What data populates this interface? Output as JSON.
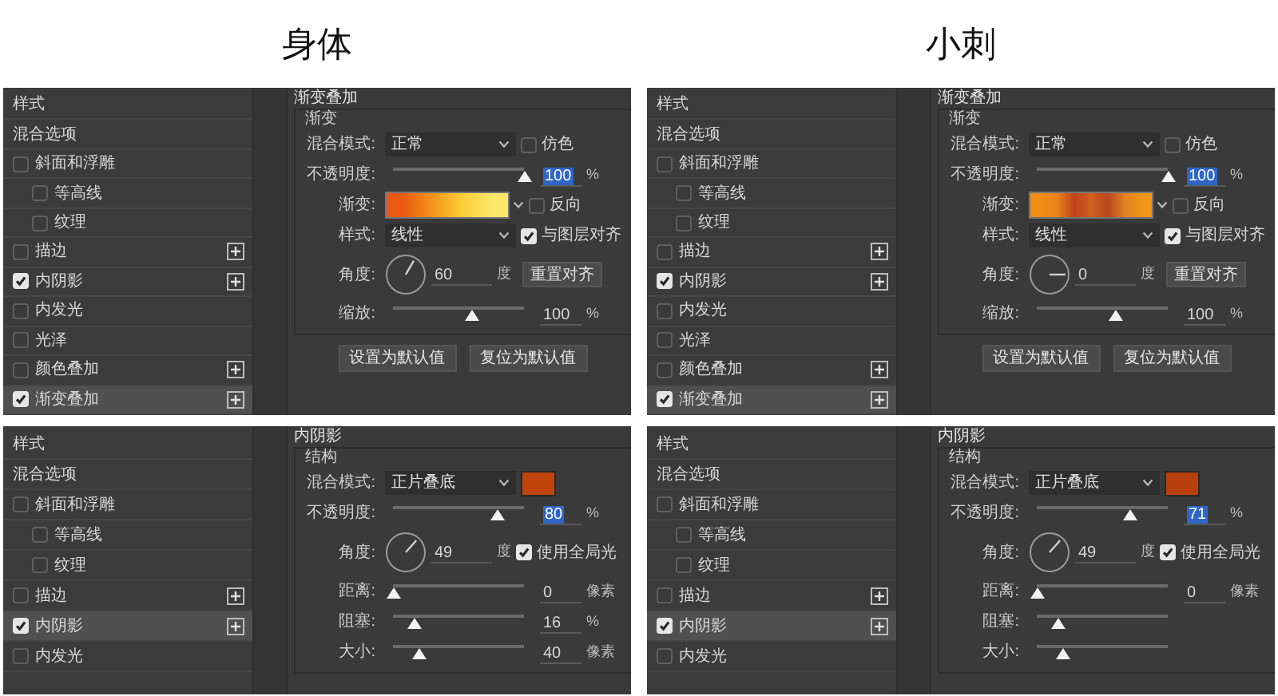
{
  "columns": [
    {
      "heading": "身体",
      "panels": [
        {
          "kind": "gradient_overlay",
          "style_list": {
            "title": "样式",
            "items": [
              {
                "kind": "plain",
                "label": "混合选项",
                "selected": false
              },
              {
                "kind": "checkbox",
                "label": "斜面和浮雕",
                "checked": false,
                "selected": false,
                "add_button": false,
                "children": [
                  {
                    "kind": "checkbox",
                    "label": "等高线",
                    "checked": false,
                    "selected": false,
                    "add_button": false
                  },
                  {
                    "kind": "checkbox",
                    "label": "纹理",
                    "checked": false,
                    "selected": false,
                    "add_button": false
                  }
                ]
              },
              {
                "kind": "checkbox",
                "label": "描边",
                "checked": false,
                "selected": false,
                "add_button": true
              },
              {
                "kind": "checkbox",
                "label": "内阴影",
                "checked": true,
                "selected": false,
                "add_button": true
              },
              {
                "kind": "checkbox",
                "label": "内发光",
                "checked": false,
                "selected": false,
                "add_button": false
              },
              {
                "kind": "checkbox",
                "label": "光泽",
                "checked": false,
                "selected": false,
                "add_button": false
              },
              {
                "kind": "checkbox",
                "label": "颜色叠加",
                "checked": false,
                "selected": false,
                "add_button": true
              },
              {
                "kind": "checkbox",
                "label": "渐变叠加",
                "checked": true,
                "selected": true,
                "add_button": true
              }
            ]
          },
          "settings": {
            "title": "渐变叠加",
            "group": "渐变",
            "rows": [
              {
                "kind": "select",
                "label": "混合模式:",
                "value": "正常",
                "option": {
                  "label": "仿色",
                  "checked": false
                }
              },
              {
                "kind": "slider",
                "label": "不透明度:",
                "level": 1,
                "value": "100",
                "unit": "%",
                "highlighted": true
              },
              {
                "kind": "gradient",
                "label": "渐变:",
                "stops": [
                  {
                    "color": "#ea5812"
                  },
                  {
                    "color": "#f4931a"
                  },
                  {
                    "color": "#fbcf38"
                  },
                  {
                    "color": "#fde86c"
                  }
                ],
                "option": {
                  "label": "反向",
                  "checked": false
                }
              },
              {
                "kind": "select",
                "label": "样式:",
                "value": "线性",
                "option": {
                  "label": "与图层对齐",
                  "checked": true
                }
              },
              {
                "kind": "angle",
                "label": "角度:",
                "value": "60",
                "unit": "度",
                "button": "重置对齐"
              },
              {
                "kind": "slider",
                "label": "缩放:",
                "level": 0.6,
                "value": "100",
                "unit": "%",
                "highlighted": false
              }
            ]
          },
          "buttons": [
            "设置为默认值",
            "复位为默认值"
          ]
        },
        {
          "kind": "inner_shadow",
          "style_list": {
            "title": "样式",
            "items": [
              {
                "kind": "plain",
                "label": "混合选项",
                "selected": false
              },
              {
                "kind": "checkbox",
                "label": "斜面和浮雕",
                "checked": false,
                "selected": false,
                "add_button": false,
                "children": [
                  {
                    "kind": "checkbox",
                    "label": "等高线",
                    "checked": false,
                    "selected": false,
                    "add_button": false
                  },
                  {
                    "kind": "checkbox",
                    "label": "纹理",
                    "checked": false,
                    "selected": false,
                    "add_button": false
                  }
                ]
              },
              {
                "kind": "checkbox",
                "label": "描边",
                "checked": false,
                "selected": false,
                "add_button": true
              },
              {
                "kind": "checkbox",
                "label": "内阴影",
                "checked": true,
                "selected": true,
                "add_button": true
              },
              {
                "kind": "checkbox",
                "label": "内发光",
                "checked": false,
                "selected": false,
                "add_button": false
              }
            ]
          },
          "settings": {
            "title": "内阴影",
            "group": "结构",
            "rows": [
              {
                "kind": "select",
                "label": "混合模式:",
                "value": "正片叠底",
                "color": "#c0440c"
              },
              {
                "kind": "slider",
                "label": "不透明度:",
                "level": 0.8,
                "value": "80",
                "unit": "%",
                "highlighted": true
              },
              {
                "kind": "angle",
                "label": "角度:",
                "value": "49",
                "unit": "度",
                "option": {
                  "label": "使用全局光",
                  "checked": true
                }
              },
              {
                "kind": "slider",
                "label": "距离:",
                "level": 0,
                "value": "0",
                "unit": "像素",
                "highlighted": false
              },
              {
                "kind": "slider",
                "label": "阻塞:",
                "level": 0.16,
                "value": "16",
                "unit": "%",
                "highlighted": false
              },
              {
                "kind": "slider",
                "label": "大小:",
                "level": 0.2,
                "value": "40",
                "unit": "像素",
                "highlighted": false
              }
            ]
          }
        }
      ]
    },
    {
      "heading": "小刺",
      "panels": [
        {
          "kind": "gradient_overlay",
          "style_list": {
            "title": "样式",
            "items": [
              {
                "kind": "plain",
                "label": "混合选项",
                "selected": false
              },
              {
                "kind": "checkbox",
                "label": "斜面和浮雕",
                "checked": false,
                "selected": false,
                "add_button": false,
                "children": [
                  {
                    "kind": "checkbox",
                    "label": "等高线",
                    "checked": false,
                    "selected": false,
                    "add_button": false
                  },
                  {
                    "kind": "checkbox",
                    "label": "纹理",
                    "checked": false,
                    "selected": false,
                    "add_button": false
                  }
                ]
              },
              {
                "kind": "checkbox",
                "label": "描边",
                "checked": false,
                "selected": false,
                "add_button": true
              },
              {
                "kind": "checkbox",
                "label": "内阴影",
                "checked": true,
                "selected": false,
                "add_button": true
              },
              {
                "kind": "checkbox",
                "label": "内发光",
                "checked": false,
                "selected": false,
                "add_button": false
              },
              {
                "kind": "checkbox",
                "label": "光泽",
                "checked": false,
                "selected": false,
                "add_button": false
              },
              {
                "kind": "checkbox",
                "label": "颜色叠加",
                "checked": false,
                "selected": false,
                "add_button": true
              },
              {
                "kind": "checkbox",
                "label": "渐变叠加",
                "checked": true,
                "selected": true,
                "add_button": true
              }
            ]
          },
          "settings": {
            "title": "渐变叠加",
            "group": "渐变",
            "rows": [
              {
                "kind": "select",
                "label": "混合模式:",
                "value": "正常",
                "option": {
                  "label": "仿色",
                  "checked": false
                }
              },
              {
                "kind": "slider",
                "label": "不透明度:",
                "level": 1,
                "value": "100",
                "unit": "%",
                "highlighted": true
              },
              {
                "kind": "gradient",
                "label": "渐变:",
                "stops": [
                  {
                    "color": "#f28c14"
                  },
                  {
                    "color": "#e9841a"
                  },
                  {
                    "color": "#c0431c"
                  },
                  {
                    "color": "#d2601e"
                  },
                  {
                    "color": "#b9461e"
                  },
                  {
                    "color": "#e38421"
                  },
                  {
                    "color": "#f2961a"
                  }
                ],
                "option": {
                  "label": "反向",
                  "checked": false
                }
              },
              {
                "kind": "select",
                "label": "样式:",
                "value": "线性",
                "option": {
                  "label": "与图层对齐",
                  "checked": true
                }
              },
              {
                "kind": "angle",
                "label": "角度:",
                "value": "0",
                "unit": "度",
                "button": "重置对齐"
              },
              {
                "kind": "slider",
                "label": "缩放:",
                "level": 0.6,
                "value": "100",
                "unit": "%",
                "highlighted": false
              }
            ]
          },
          "buttons": [
            "设置为默认值",
            "复位为默认值"
          ]
        },
        {
          "kind": "inner_shadow",
          "style_list": {
            "title": "样式",
            "items": [
              {
                "kind": "plain",
                "label": "混合选项",
                "selected": false
              },
              {
                "kind": "checkbox",
                "label": "斜面和浮雕",
                "checked": false,
                "selected": false,
                "add_button": false,
                "children": [
                  {
                    "kind": "checkbox",
                    "label": "等高线",
                    "checked": false,
                    "selected": false,
                    "add_button": false
                  },
                  {
                    "kind": "checkbox",
                    "label": "纹理",
                    "checked": false,
                    "selected": false,
                    "add_button": false
                  }
                ]
              },
              {
                "kind": "checkbox",
                "label": "描边",
                "checked": false,
                "selected": false,
                "add_button": true
              },
              {
                "kind": "checkbox",
                "label": "内阴影",
                "checked": true,
                "selected": true,
                "add_button": true
              },
              {
                "kind": "checkbox",
                "label": "内发光",
                "checked": false,
                "selected": false,
                "add_button": false
              }
            ]
          },
          "settings": {
            "title": "内阴影",
            "group": "结构",
            "rows": [
              {
                "kind": "select",
                "label": "混合模式:",
                "value": "正片叠底",
                "color": "#b8400e"
              },
              {
                "kind": "slider",
                "label": "不透明度:",
                "level": 0.71,
                "value": "71",
                "unit": "%",
                "highlighted": true
              },
              {
                "kind": "angle",
                "label": "角度:",
                "value": "49",
                "unit": "度",
                "option": {
                  "label": "使用全局光",
                  "checked": true
                }
              },
              {
                "kind": "slider",
                "label": "距离:",
                "level": 0,
                "value": "0",
                "unit": "像素",
                "highlighted": false
              },
              {
                "kind": "slider",
                "label": "阻塞:",
                "level": 0.16
              },
              {
                "kind": "slider",
                "label": "大小:",
                "level": 0.2
              }
            ]
          }
        }
      ]
    }
  ]
}
